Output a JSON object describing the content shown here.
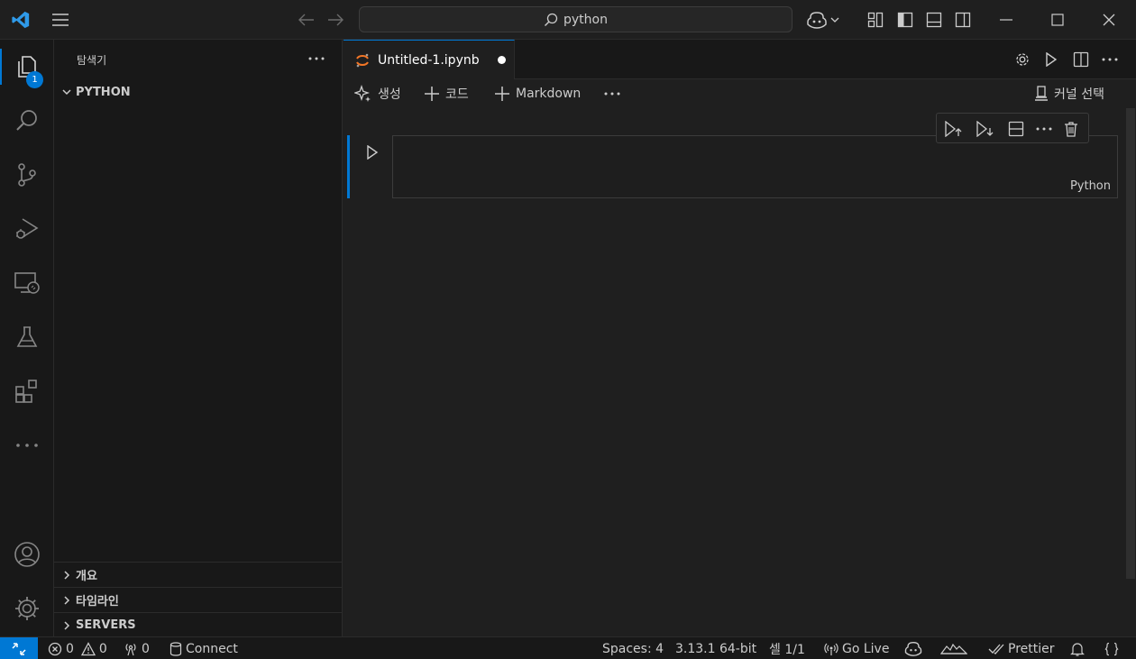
{
  "titlebar": {
    "search_text": "python"
  },
  "activity": {
    "explorer_badge": "1"
  },
  "sidebar": {
    "title": "탐색기",
    "folder": "PYTHON",
    "sections": [
      "개요",
      "타임라인",
      "SERVERS"
    ]
  },
  "tab": {
    "label": "Untitled-1.ipynb"
  },
  "notebook_toolbar": {
    "generate": "생성",
    "code": "코드",
    "markdown": "Markdown",
    "kernel": "커널 선택"
  },
  "cell": {
    "language": "Python"
  },
  "status": {
    "errors": "0",
    "warnings": "0",
    "ports": "0",
    "connect": "Connect",
    "spaces": "Spaces: 4",
    "python_version": "3.13.1 64-bit",
    "cell_pos": "셀 1/1",
    "go_live": "Go Live",
    "prettier": "Prettier"
  },
  "colors": {
    "accent": "#0078d4",
    "background": "#1f1f1f",
    "sidebar": "#181818"
  }
}
